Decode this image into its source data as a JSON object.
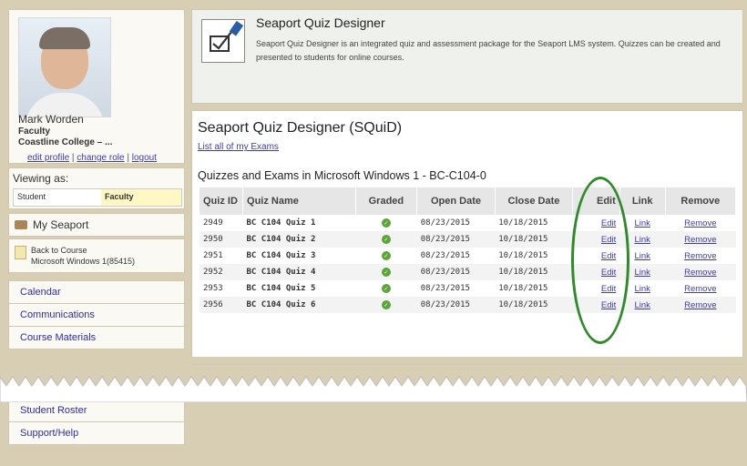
{
  "profile": {
    "name": "Mark Worden",
    "role": "Faculty",
    "college": "Coastline College – ...",
    "links": [
      "edit profile",
      "change role",
      "logout"
    ],
    "separator": " | "
  },
  "viewing": {
    "label": "Viewing as:",
    "options": [
      "Student",
      "Faculty"
    ]
  },
  "my_seaport": "My Seaport",
  "back": {
    "line1": "Back to Course",
    "line2": "Microsoft Windows 1(85415)"
  },
  "nav_top": [
    "Calendar",
    "Communications",
    "Course Materials"
  ],
  "nav_bottom": [
    "Student Roster",
    "Support/Help"
  ],
  "header": {
    "title": "Seaport Quiz Designer",
    "description": "Seaport Quiz Designer is an integrated quiz and assessment package for the Seaport LMS system. Quizzes can be created and presented to students for online courses."
  },
  "content": {
    "title": "Seaport Quiz Designer (SQuiD)",
    "list_link": "List all of my Exams",
    "subtitle": "Quizzes and Exams in Microsoft Windows 1 - BC-C104-0"
  },
  "table": {
    "headers": [
      "Quiz ID",
      "Quiz Name",
      "Graded",
      "Open Date",
      "Close Date",
      "Edit",
      "Link",
      "Remove"
    ],
    "rows": [
      {
        "id": "2949",
        "name": "BC C104 Quiz 1",
        "open": "08/23/2015",
        "close": "10/18/2015",
        "edit": "Edit",
        "link": "Link",
        "remove": "Remove"
      },
      {
        "id": "2950",
        "name": "BC C104 Quiz 2",
        "open": "08/23/2015",
        "close": "10/18/2015",
        "edit": "Edit",
        "link": "Link",
        "remove": "Remove"
      },
      {
        "id": "2951",
        "name": "BC C104 Quiz 3",
        "open": "08/23/2015",
        "close": "10/18/2015",
        "edit": "Edit",
        "link": "Link",
        "remove": "Remove"
      },
      {
        "id": "2952",
        "name": "BC C104 Quiz 4",
        "open": "08/23/2015",
        "close": "10/18/2015",
        "edit": "Edit",
        "link": "Link",
        "remove": "Remove"
      },
      {
        "id": "2953",
        "name": "BC C104 Quiz 5",
        "open": "08/23/2015",
        "close": "10/18/2015",
        "edit": "Edit",
        "link": "Link",
        "remove": "Remove"
      },
      {
        "id": "2956",
        "name": "BC C104 Quiz 6",
        "open": "08/23/2015",
        "close": "10/18/2015",
        "edit": "Edit",
        "link": "Link",
        "remove": "Remove"
      }
    ]
  },
  "icons": {
    "graded": "check-circle-icon",
    "header": "pencil-checkbox-icon"
  },
  "colors": {
    "highlight_oval": "#2f8a2a",
    "graded_check": "#5ba53a",
    "link": "#3b3bb5"
  }
}
